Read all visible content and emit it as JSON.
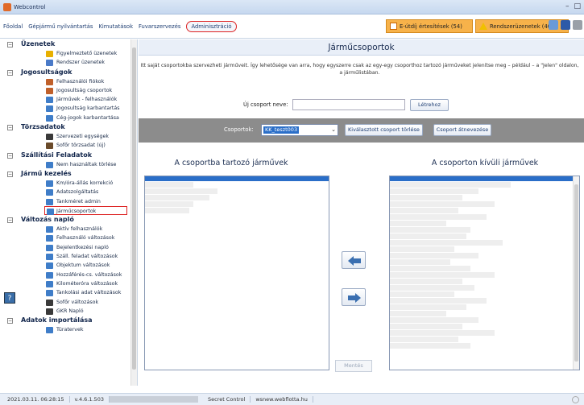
{
  "window": {
    "title": "Webcontrol"
  },
  "menu": {
    "items": [
      {
        "label": "Főoldal"
      },
      {
        "label": "Gépjármű nyilvántartás"
      },
      {
        "label": "Kimutatások"
      },
      {
        "label": "Fuvarszervezés"
      },
      {
        "label": "Adminisztráció",
        "active": true
      }
    ]
  },
  "notifications": {
    "email": "E-útdíj értesítések (54)",
    "system": "Rendszerüzenetek (404)"
  },
  "sidebar": {
    "sections": [
      {
        "label": "Üzenetek",
        "toggle": "−",
        "items": [
          {
            "label": "Figyelmeztető üzenetek",
            "icon": "warning-icon",
            "color": "#e8b000"
          },
          {
            "label": "Rendszer üzenetek",
            "icon": "envelope-icon",
            "color": "#4a7ac8"
          }
        ]
      },
      {
        "label": "Jogosultságok",
        "toggle": "−",
        "items": [
          {
            "label": "Felhasználói fiókok",
            "icon": "user-icon",
            "color": "#c0602a"
          },
          {
            "label": "Jogosultság csoportok",
            "icon": "users-icon",
            "color": "#c0602a"
          },
          {
            "label": "Járművek - felhasználók",
            "icon": "form-icon",
            "color": "#3f7dc8"
          },
          {
            "label": "Jogosultság karbantartás",
            "icon": "form-icon",
            "color": "#3f7dc8"
          },
          {
            "label": "Cég-jogok karbantartása",
            "icon": "form-icon",
            "color": "#3f7dc8"
          }
        ]
      },
      {
        "label": "Törzsadatok",
        "toggle": "−",
        "items": [
          {
            "label": "Szervezeti egységek",
            "icon": "org-icon",
            "color": "#3a3a3a"
          },
          {
            "label": "Sofőr törzsadat (új)",
            "icon": "driver-icon",
            "color": "#6a4a2a"
          }
        ]
      },
      {
        "label": "Szállítási Feladatok",
        "toggle": "−",
        "items": [
          {
            "label": "Nem használtak törlése",
            "icon": "form-icon",
            "color": "#3f7dc8"
          }
        ]
      },
      {
        "label": "Jármű kezelés",
        "toggle": "−",
        "items": [
          {
            "label": "Km/óra-állás korrekció",
            "icon": "form-icon",
            "color": "#3f7dc8"
          },
          {
            "label": "Adatszolgáltatás",
            "icon": "form-icon",
            "color": "#3f7dc8"
          },
          {
            "label": "Tankméret admin",
            "icon": "form-icon",
            "color": "#3f7dc8"
          },
          {
            "label": "Járműcsoportok",
            "icon": "form-icon",
            "color": "#3f7dc8",
            "selected": true
          }
        ]
      },
      {
        "label": "Változás napló",
        "toggle": "−",
        "items": [
          {
            "label": "Aktív felhasználók",
            "icon": "form-icon",
            "color": "#3f7dc8"
          },
          {
            "label": "Felhasználó változások",
            "icon": "form-icon",
            "color": "#3f7dc8"
          },
          {
            "label": "Bejelentkezési napló",
            "icon": "form-icon",
            "color": "#3f7dc8"
          },
          {
            "label": "Száll. feladat változások",
            "icon": "form-icon",
            "color": "#3f7dc8"
          },
          {
            "label": "Objektum változások",
            "icon": "form-icon",
            "color": "#3f7dc8"
          },
          {
            "label": "Hozzáférés-cs. változások",
            "icon": "form-icon",
            "color": "#3f7dc8"
          },
          {
            "label": "Kilométeróra változások",
            "icon": "form-icon",
            "color": "#3f7dc8"
          },
          {
            "label": "Tankolási adat változások",
            "icon": "form-icon",
            "color": "#3f7dc8"
          },
          {
            "label": "Sofőr változások",
            "icon": "org-icon",
            "color": "#3a3a3a"
          },
          {
            "label": "GKR Napló",
            "icon": "org-icon",
            "color": "#3a3a3a"
          }
        ]
      },
      {
        "label": "Adatok importálása",
        "toggle": "−",
        "items": [
          {
            "label": "Túratervek",
            "icon": "form-icon",
            "color": "#3f7dc8"
          }
        ]
      }
    ]
  },
  "main": {
    "title": "Járműcsoportok",
    "description": "Itt saját csoportokba szervezheti járműveit. Így lehetősége van arra, hogy egyszerre csak az egy-egy csoporthoz tartozó járműveket jelenítse meg – például – a \"Jelen\" oldalon, a járműlistában.",
    "new_group_label": "Új csoport neve:",
    "new_group_value": "",
    "create_button": "Létrehoz",
    "groups_label": "Csoportok:",
    "selected_group": "KK_teszt003",
    "delete_button": "Kiválasztott csoport törlése",
    "rename_button": "Csoport átnevezése",
    "in_group_title": "A csoportba tartozó járművek",
    "out_group_title": "A csoporton kívüli járművek",
    "save_button": "Mentés"
  },
  "status": {
    "datetime": "2021.03.11. 06:28:15",
    "version": "v.4.6.1.503",
    "company": "Secret Control",
    "site": "wsnew.webflotta.hu"
  }
}
